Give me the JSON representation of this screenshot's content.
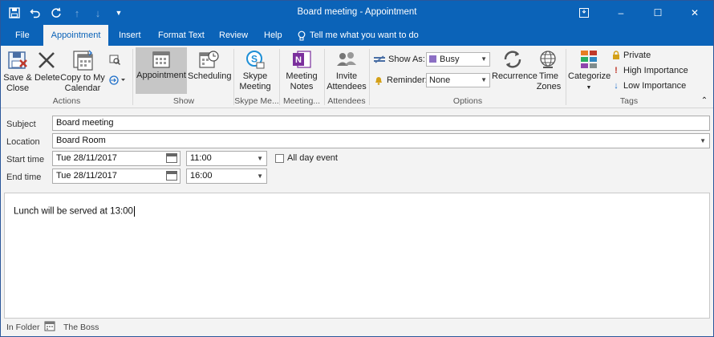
{
  "window": {
    "title": "Board meeting  -  Appointment",
    "restore_icon": "ribbon-display-icon",
    "minimize": "–",
    "maximize": "☐",
    "close": "✕"
  },
  "tabs": {
    "file": "File",
    "appointment": "Appointment",
    "insert": "Insert",
    "format_text": "Format Text",
    "review": "Review",
    "help": "Help",
    "tell_me": "Tell me what you want to do"
  },
  "ribbon": {
    "actions": {
      "save_close": "Save &\nClose",
      "save_close_l1": "Save &",
      "save_close_l2": "Close",
      "delete": "Delete",
      "copy_l1": "Copy to My",
      "copy_l2": "Calendar",
      "group": "Actions"
    },
    "show": {
      "appointment": "Appointment",
      "scheduling": "Scheduling",
      "group": "Show"
    },
    "skype": {
      "l1": "Skype",
      "l2": "Meeting",
      "group": "Skype Me..."
    },
    "meeting_notes": {
      "l1": "Meeting",
      "l2": "Notes",
      "group": "Meeting..."
    },
    "attendees": {
      "l1": "Invite",
      "l2": "Attendees",
      "group": "Attendees"
    },
    "options": {
      "show_as_label": "Show As:",
      "show_as_value": "Busy",
      "reminder_label": "Reminder:",
      "reminder_value": "None",
      "recurrence": "Recurrence",
      "time_zones_l1": "Time",
      "time_zones_l2": "Zones",
      "group": "Options"
    },
    "tags": {
      "categorize": "Categorize",
      "private": "Private",
      "high": "High Importance",
      "low": "Low Importance",
      "group": "Tags"
    }
  },
  "form": {
    "subject_label": "Subject",
    "subject_value": "Board meeting",
    "location_label": "Location",
    "location_value": "Board Room",
    "start_label": "Start time",
    "start_date": "Tue 28/11/2017",
    "start_time": "11:00",
    "all_day": "All day event",
    "end_label": "End time",
    "end_date": "Tue 28/11/2017",
    "end_time": "16:00",
    "body": "Lunch will be served at 13:00"
  },
  "status": {
    "in_folder_label": "In Folder",
    "folder_name": "The Boss"
  },
  "colors": {
    "accent": "#0b63b8",
    "ribbon_bg": "#f3f3f3",
    "busy_swatch": "#8c6fc4",
    "importance_high": "#c0392b",
    "importance_low": "#1e6fc9",
    "onenote": "#7b2f9d"
  }
}
